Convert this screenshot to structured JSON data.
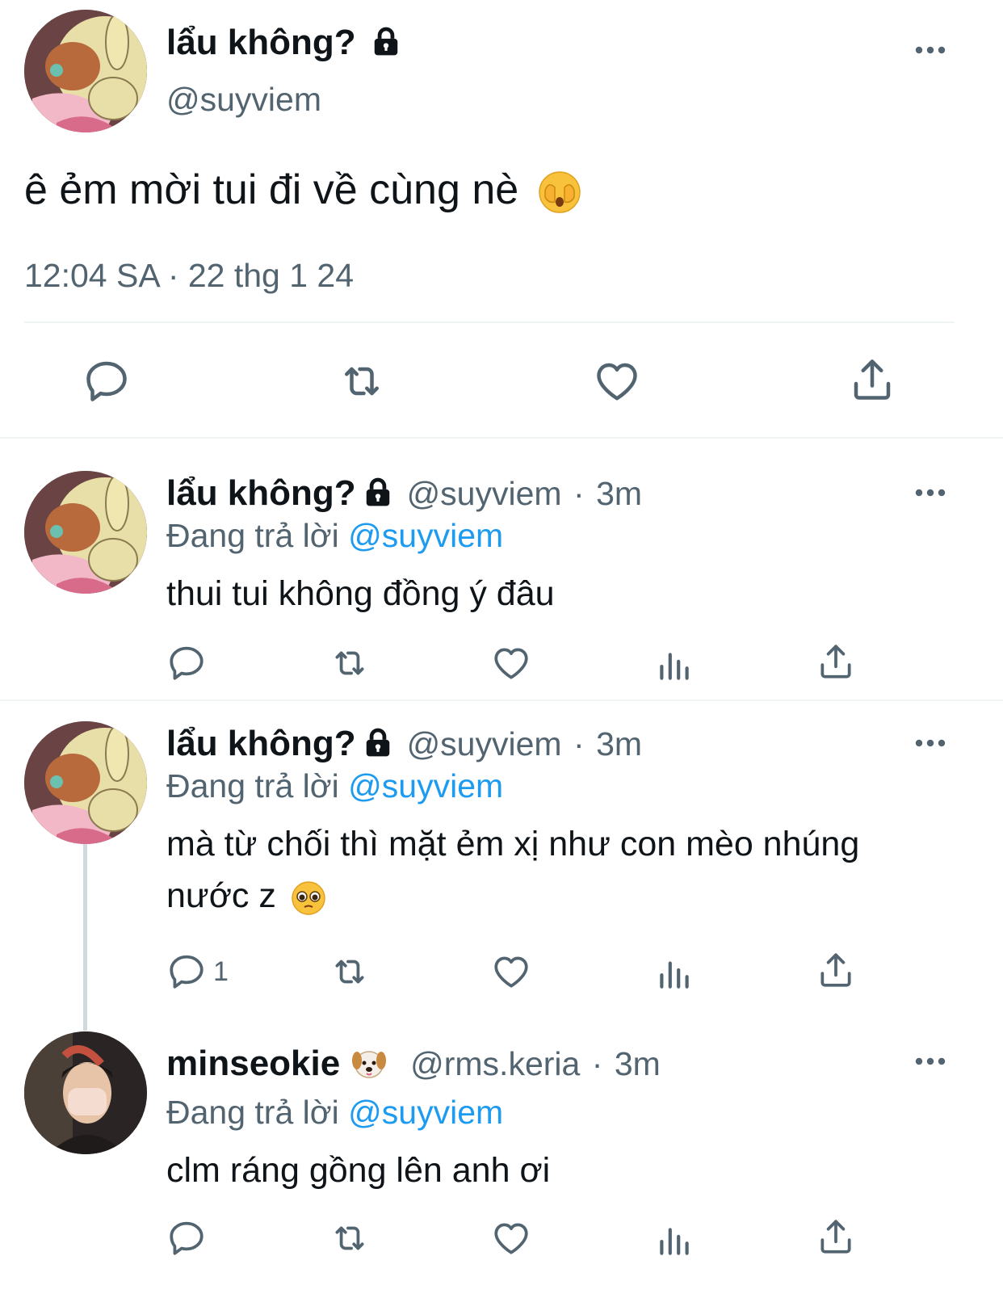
{
  "main_tweet": {
    "display_name": "lẩu không?",
    "handle": "@suyviem",
    "text": "ê ẻm mời tui đi về cùng nè",
    "emoji": "face-with-hand-over-mouth",
    "timestamp": "12:04 SA · 22 thg 1 24",
    "actions": [
      "reply-icon",
      "retweet-icon",
      "like-icon",
      "share-icon"
    ]
  },
  "replies": [
    {
      "display_name": "lẩu không?",
      "handle": "@suyviem",
      "sep": "·",
      "time": "3m",
      "replying_label": "Đang trả lời",
      "replying_to": "@suyviem",
      "text": "thui tui không đồng ý đâu",
      "reply_count": ""
    },
    {
      "display_name": "lẩu không?",
      "handle": "@suyviem",
      "sep": "·",
      "time": "3m",
      "replying_label": "Đang trả lời",
      "replying_to": "@suyviem",
      "text_line1": "mà từ chối thì mặt ẻm xị như con mèo nhúng",
      "text_line2": "nước z",
      "reply_count": "1"
    },
    {
      "display_name": "minseokie",
      "handle": "@rms.keria",
      "sep": "·",
      "time": "3m",
      "replying_label": "Đang trả lời",
      "replying_to": "@suyviem",
      "text": "clm ráng gồng lên anh ơi",
      "reply_count": ""
    }
  ],
  "colors": {
    "text": "#0f1419",
    "secondary": "#536471",
    "link": "#1d9bf0",
    "divider": "#eff3f4"
  }
}
